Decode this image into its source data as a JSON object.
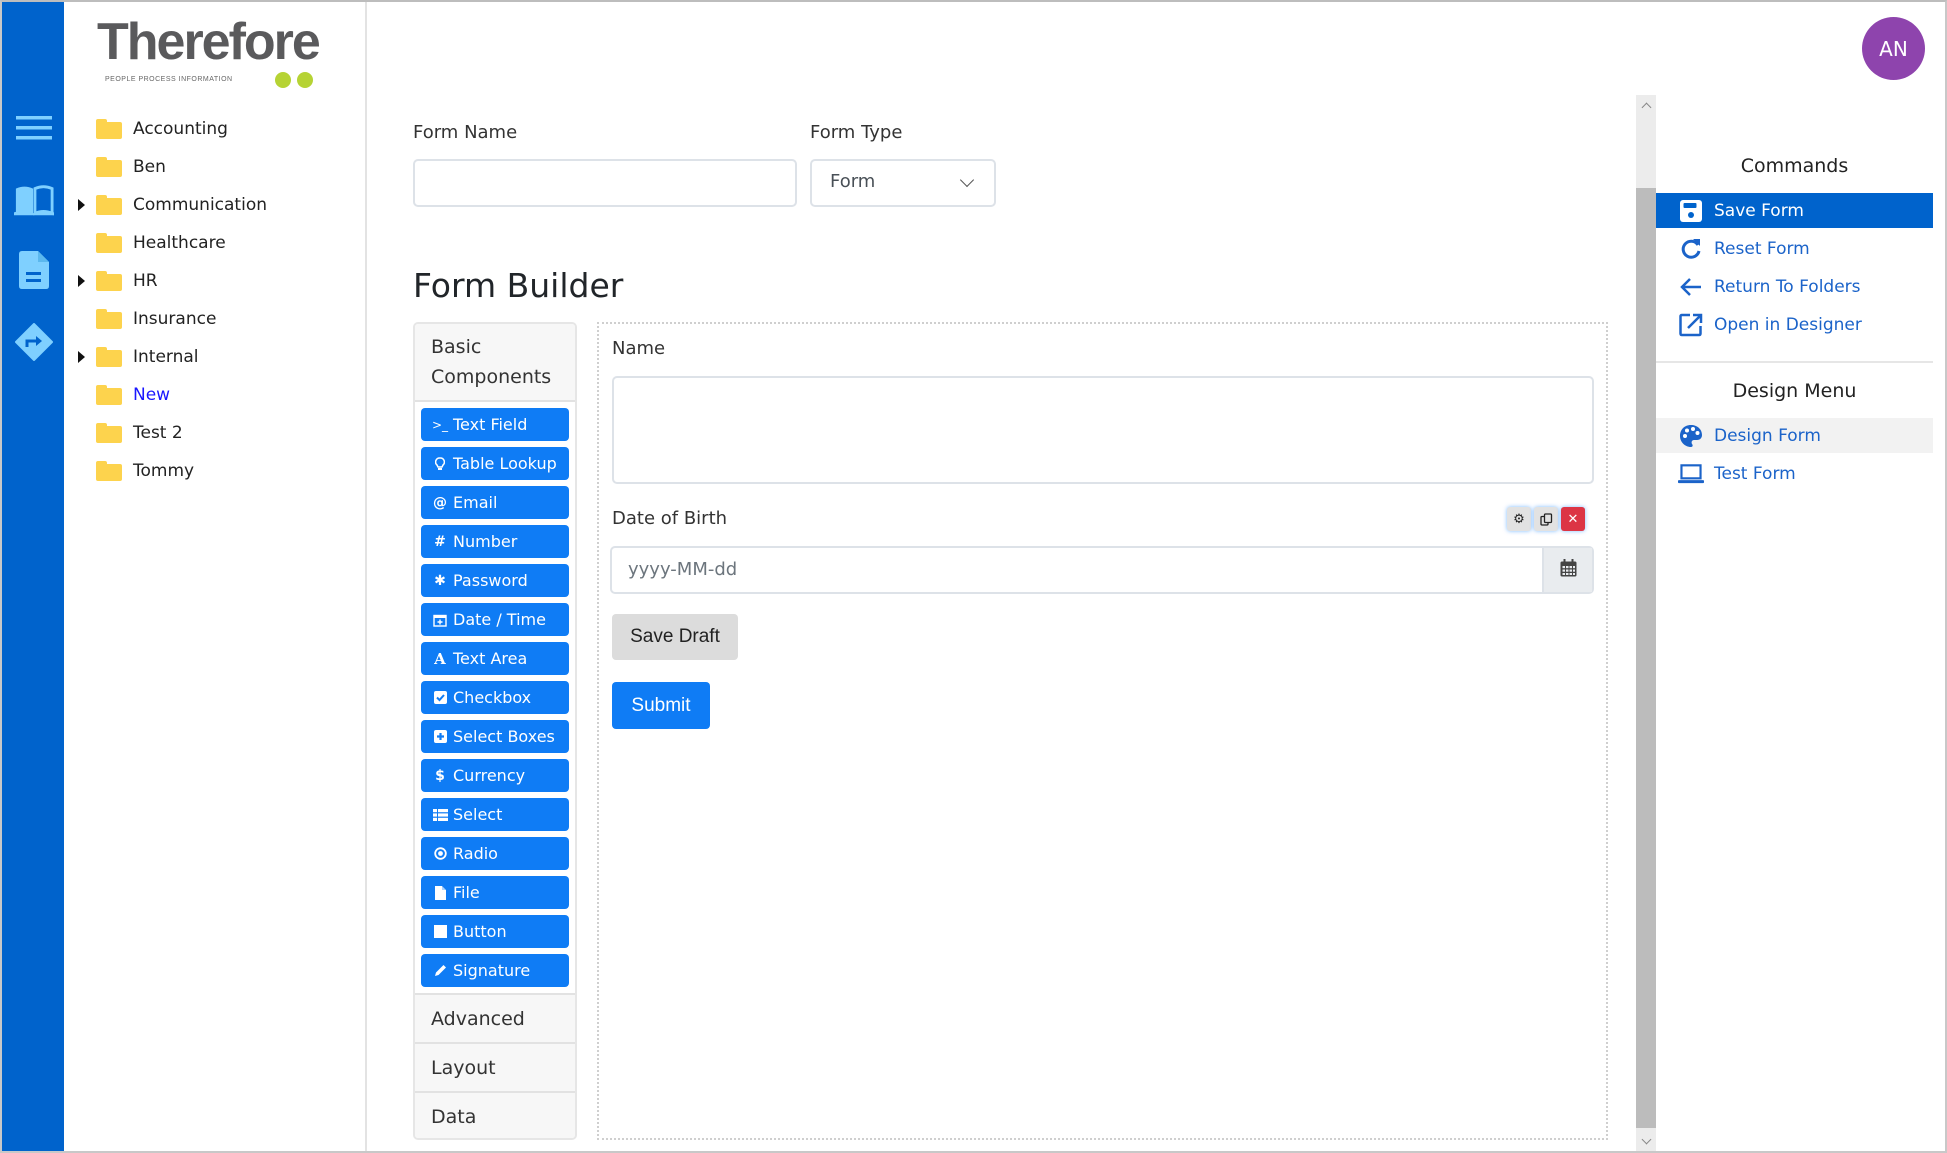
{
  "nav": {
    "icons": [
      "menu-icon",
      "book-icon",
      "document-icon",
      "workflow-icon"
    ]
  },
  "logo": {
    "name": "Therefore",
    "tagline": "PEOPLE  PROCESS  INFORMATION",
    "accent": "#b6d334"
  },
  "tree": {
    "items": [
      {
        "label": "Accounting",
        "expandable": false,
        "active": false
      },
      {
        "label": "Ben",
        "expandable": false,
        "active": false
      },
      {
        "label": "Communication",
        "expandable": true,
        "active": false
      },
      {
        "label": "Healthcare",
        "expandable": false,
        "active": false
      },
      {
        "label": "HR",
        "expandable": true,
        "active": false
      },
      {
        "label": "Insurance",
        "expandable": false,
        "active": false
      },
      {
        "label": "Internal",
        "expandable": true,
        "active": false
      },
      {
        "label": "New",
        "expandable": false,
        "active": true
      },
      {
        "label": "Test 2",
        "expandable": false,
        "active": false
      },
      {
        "label": "Tommy",
        "expandable": false,
        "active": false
      }
    ]
  },
  "form_header": {
    "form_name_label": "Form Name",
    "form_name_value": "",
    "form_type_label": "Form Type",
    "form_type_value": "Form"
  },
  "builder": {
    "title": "Form Builder",
    "components_header": "Basic Components",
    "components": [
      {
        "label": "Text Field",
        "icon": ">_"
      },
      {
        "label": "Table Lookup",
        "icon": "lightbulb"
      },
      {
        "label": "Email",
        "icon": "@"
      },
      {
        "label": "Number",
        "icon": "#"
      },
      {
        "label": "Password",
        "icon": "asterisk"
      },
      {
        "label": "Date / Time",
        "icon": "calendar-plus"
      },
      {
        "label": "Text Area",
        "icon": "font"
      },
      {
        "label": "Checkbox",
        "icon": "check-square"
      },
      {
        "label": "Select Boxes",
        "icon": "plus-square"
      },
      {
        "label": "Currency",
        "icon": "$"
      },
      {
        "label": "Select",
        "icon": "th-list"
      },
      {
        "label": "Radio",
        "icon": "dot-circle"
      },
      {
        "label": "File",
        "icon": "file"
      },
      {
        "label": "Button",
        "icon": "stop"
      },
      {
        "label": "Signature",
        "icon": "pencil"
      }
    ],
    "sections": [
      "Advanced",
      "Layout",
      "Data"
    ]
  },
  "canvas": {
    "name_label": "Name",
    "name_value": "",
    "dob_label": "Date of Birth",
    "dob_placeholder": "yyyy-MM-dd",
    "save_draft_label": "Save Draft",
    "submit_label": "Submit"
  },
  "user": {
    "initials": "AN",
    "avatar_color": "#8e44ad"
  },
  "commands": {
    "heading": "Commands",
    "items": [
      {
        "label": "Save Form",
        "icon": "save-icon",
        "active": true
      },
      {
        "label": "Reset Form",
        "icon": "refresh-icon",
        "active": false
      },
      {
        "label": "Return To Folders",
        "icon": "arrow-left-icon",
        "active": false
      },
      {
        "label": "Open in Designer",
        "icon": "external-link-icon",
        "active": false
      }
    ]
  },
  "design_menu": {
    "heading": "Design Menu",
    "items": [
      {
        "label": "Design Form",
        "icon": "palette-icon",
        "hover": true
      },
      {
        "label": "Test Form",
        "icon": "laptop-icon",
        "hover": false
      }
    ]
  },
  "colors": {
    "nav_blue": "#0063cc",
    "button_blue": "#0f7cf5",
    "link_blue": "#1b63c9",
    "delete_red": "#dc3545",
    "folder_yellow": "#fdd34d"
  }
}
